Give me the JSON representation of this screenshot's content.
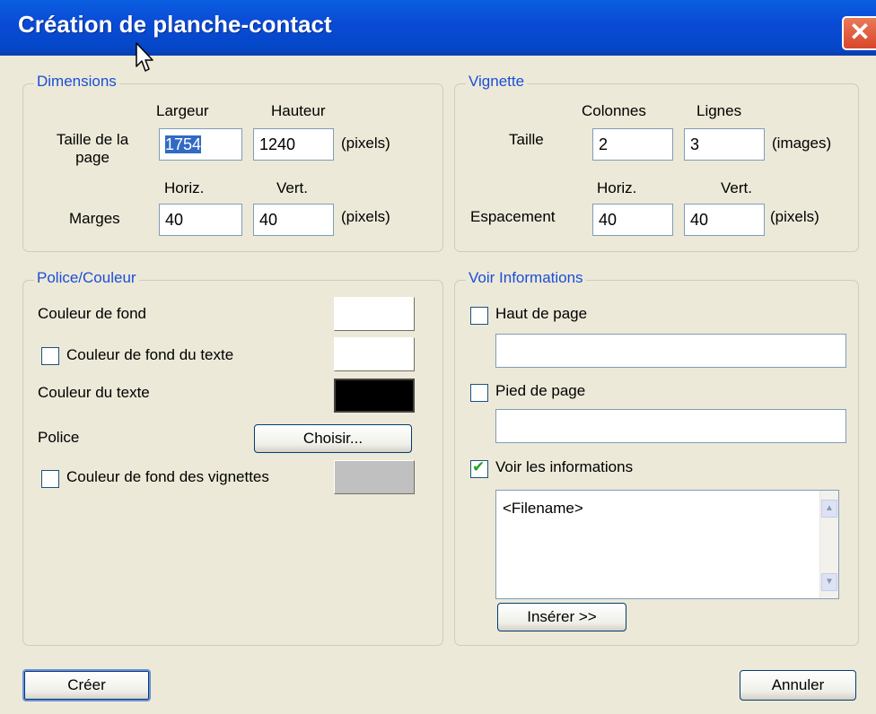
{
  "window": {
    "title": "Création de planche-contact",
    "close_label": "✕"
  },
  "dimensions": {
    "legend": "Dimensions",
    "col_largeur": "Largeur",
    "col_hauteur": "Hauteur",
    "page_size_label": "Taille de la page",
    "page_width": "1754",
    "page_height": "1240",
    "unit": "(pixels)",
    "col_horiz": "Horiz.",
    "col_vert": "Vert.",
    "margins_label": "Marges",
    "margin_h": "40",
    "margin_v": "40"
  },
  "vignette": {
    "legend": "Vignette",
    "col_colonnes": "Colonnes",
    "col_lignes": "Lignes",
    "size_label": "Taille",
    "columns": "2",
    "rows": "3",
    "unit_images": "(images)",
    "col_horiz": "Horiz.",
    "col_vert": "Vert.",
    "spacing_label": "Espacement",
    "spacing_h": "40",
    "spacing_v": "40",
    "unit_pixels": "(pixels)"
  },
  "police": {
    "legend": "Police/Couleur",
    "bg_color_label": "Couleur de fond",
    "bg_color": "#ffffff",
    "text_bg_label": "Couleur de fond du texte",
    "text_bg_checked": false,
    "text_bg_color": "#ffffff",
    "text_color_label": "Couleur du texte",
    "text_color": "#000000",
    "font_label": "Police",
    "choose_button": "Choisir...",
    "thumb_bg_label": "Couleur de fond des vignettes",
    "thumb_bg_checked": false,
    "thumb_bg_color": "#c0c0c0"
  },
  "info": {
    "legend": "Voir Informations",
    "header_label": "Haut de page",
    "header_checked": false,
    "header_value": "",
    "footer_label": "Pied de page",
    "footer_checked": false,
    "footer_value": "",
    "show_info_label": "Voir les informations",
    "show_info_checked": true,
    "info_text": "<Filename>",
    "insert_button": "Insérer >>"
  },
  "footer": {
    "create_button": "Créer",
    "cancel_button": "Annuler"
  }
}
